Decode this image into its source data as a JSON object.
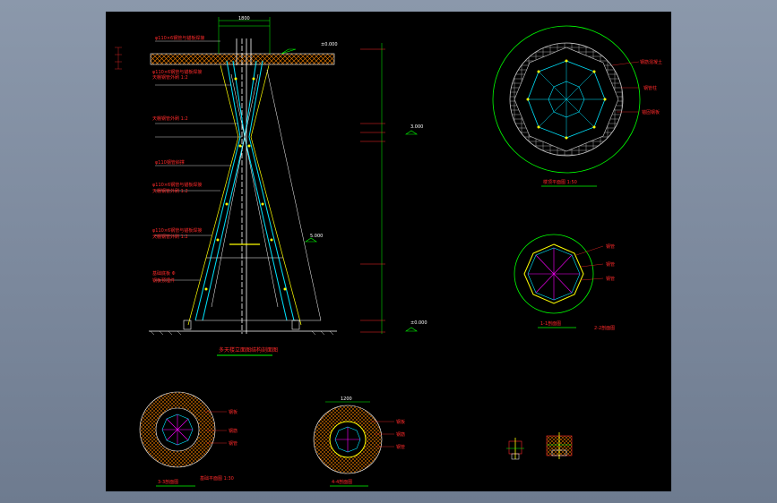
{
  "colors": {
    "background": "#7d8a9e",
    "canvas": "#000000",
    "annotation": "#ff2a2a",
    "dimension": "#00ff00",
    "cyan": "#00e5ff",
    "white": "#ffffff",
    "yellow": "#ffff00",
    "magenta": "#ff00ff",
    "orange": "#ff8800"
  },
  "drawing": {
    "elevation_title": "多天楼立面图结构剖面图",
    "top_dimension": "1800",
    "elevation_marks": [
      "±0.000",
      "3.000",
      "5.000",
      "±0.000"
    ]
  },
  "callouts": {
    "left": [
      "φ110×6钢管与锚板焊接",
      "天棚钢管外刷 1:2",
      "φ110×6钢管与锚板焊接",
      "天棚钢管外刷 1:2",
      "φ110钢管斜撑",
      "φ110×6钢管与锚板焊接",
      "天棚钢管外刷 1:2",
      "φ110×6钢管与锚板焊接",
      "天棚钢管外刷 1:2",
      "基础底板 Φ",
      "钢板预埋件"
    ],
    "right_top": [
      "钢筋混凝土",
      "钢管柱",
      "锚固钢板"
    ],
    "right_mid": [
      "钢管",
      "钢管",
      "钢管"
    ],
    "bottom_left": [
      "钢板",
      "钢筋",
      "钢管"
    ],
    "bottom_mid": [
      "钢板",
      "钢筋",
      "钢管"
    ]
  },
  "section_titles": {
    "top_plan": "楼顶平面图 1:50",
    "mid_plan": "1-1剖面图",
    "mid_plan_note": "2-2剖面图",
    "bottom_left": "3-3剖面图",
    "bottom_left_note": "基础平面图 1:30",
    "bottom_mid": "4-4剖面图",
    "bottom_mid_dim": "1200"
  }
}
